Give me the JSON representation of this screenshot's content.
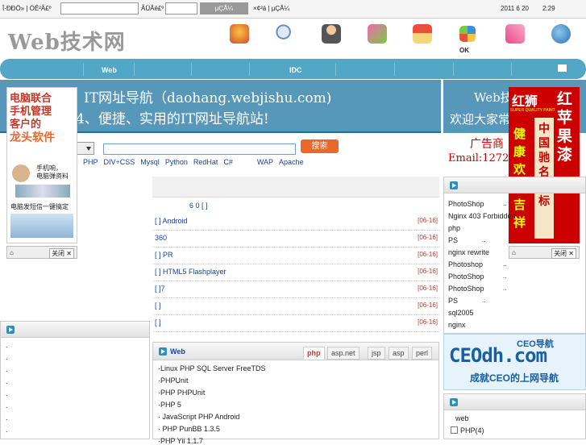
{
  "topbar": {
    "label1": "Î·ÐÐÖ» | ÓÊ²Å£º",
    "label2": "ÃÜÂë£º",
    "login_btn": "µÇÂ¼",
    "register": "×¢²á | µÇÂ¼",
    "date": "2011 6 20",
    "time": "2:29"
  },
  "header": {
    "logo": "Web技术网",
    "ok_label": "OK",
    "icons": [
      "gift-icon",
      "search-icon",
      "user-icon",
      "bird-icon",
      "home-icon",
      "puzzle-icon",
      "book-icon",
      "globe-icon"
    ]
  },
  "nav": {
    "items": [
      "Web",
      "IDC"
    ]
  },
  "banner": {
    "line1": "IT网址导航（daohang.webjishu.com)",
    "line2": "4、便捷、实用的IT网址导航站!",
    "right1": "Web技",
    "right2": "欢迎大家常"
  },
  "ad": {
    "text": "广告商",
    "email": "Email:12722"
  },
  "search": {
    "button": "搜索",
    "quick": [
      "S",
      "PHP",
      "DIV+CSS",
      "Mysql",
      "Python",
      "RedHat",
      "C#",
      "WAP",
      "Apache"
    ]
  },
  "left_ad": {
    "l1": "电脑联合",
    "l2": "手机管理",
    "l3": "客户的",
    "l4": "龙头软件",
    "l5": "手机响，",
    "l6": "电脑弹资料",
    "l7": "电脑发短信一键搞定",
    "close": "关闭"
  },
  "right_ad": {
    "brand": "红狮",
    "sub": "SUPER QUALITY PAINT",
    "big": "红苹果漆",
    "side": "中国驰名商标",
    "col": "健康欢乐吉祥",
    "close": "关闭"
  },
  "center": {
    "count": "6    0 [ ]",
    "news": [
      {
        "title": "[ ]      Android",
        "date": "[06-16]"
      },
      {
        "title": "                   360",
        "date": "[06-16]"
      },
      {
        "title": "[ ] PR",
        "date": "[06-16]"
      },
      {
        "title": "[ ]  HTML5        Flashplayer",
        "date": "[06-16]"
      },
      {
        "title": "[ ]7",
        "date": "[06-16]"
      },
      {
        "title": "[ ]",
        "date": "[06-16]"
      },
      {
        "title": "[ ]",
        "date": "[06-16]"
      }
    ]
  },
  "web_panel": {
    "title": "Web",
    "tabs": [
      "php",
      "asp.net",
      "jsp",
      "asp",
      "perl"
    ],
    "items": [
      "·Linux PHP  SQL Server FreeTDS",
      "·PHPUnit",
      "·PHP       PHPUnit",
      "·PHP 5",
      "·  JavaScript PHP  Android",
      "·    PHP     PunBB 1.3.5",
      "·PHP  Yii 1.1.7"
    ]
  },
  "left_panel": {
    "rows": [
      ".",
      ".",
      ".",
      ".",
      ".",
      ".",
      ".",
      ".",
      "."
    ]
  },
  "right_list": {
    "items": [
      "PhotoShop",
      "Nginx 403 Forbidden",
      "php",
      "PS",
      "nginx rewrite",
      "Photoshop",
      "PhotoShop",
      "PhotoShop",
      "PS",
      "   sql2005",
      "nginx"
    ],
    "dots": [
      "..",
      "..",
      "",
      "..",
      "",
      "..",
      "..",
      "..",
      "..",
      "",
      ""
    ]
  },
  "ceo": {
    "top": "CEO导航",
    "big": "CEOdh.com",
    "slogan": "成就CEO的上网导航"
  },
  "right_panel2": {
    "items": [
      "web",
      "PHP(4)"
    ]
  },
  "colors": {
    "nav": "#52a7c7",
    "banner": "#5797b9",
    "accent": "#e8692a",
    "date": "#c0392b"
  }
}
